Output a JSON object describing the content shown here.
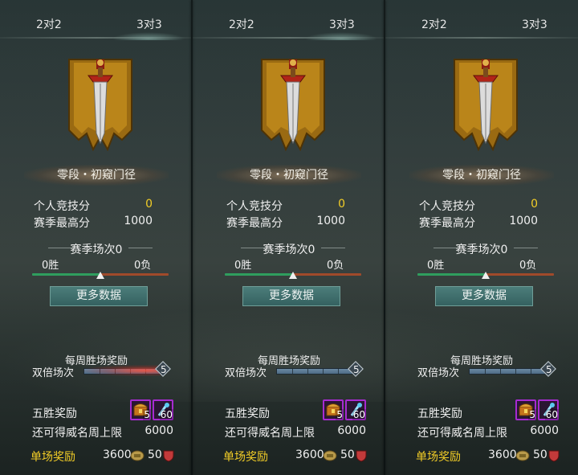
{
  "colors": {
    "accent_yellow": "#f2cd27",
    "button_teal": "#42706e",
    "item_border": "#a72bd1"
  },
  "panels": [
    {
      "tabs": [
        "2对2",
        "3对3"
      ],
      "rank_name": "零段・初窥门径",
      "personal_score_label": "个人竞技分",
      "personal_score": "0",
      "season_high_label": "赛季最高分",
      "season_high": "1000",
      "season_matches": "赛季场次0",
      "wins": "0胜",
      "losses": "0负",
      "more_data": "更多数据",
      "weekly_reward_title": "每周胜场奖励",
      "double_matches_label": "双倍场次",
      "double_matches_value": "5",
      "five_win_label": "五胜奖励",
      "item1_qty": "5",
      "item2_qty": "60",
      "remaining_label": "还可得威名周上限",
      "remaining_value": "6000",
      "single_reward_label": "单场奖励",
      "single_coin": "3600",
      "single_badge": "50"
    },
    {
      "tabs": [
        "2对2",
        "3对3"
      ],
      "rank_name": "零段・初窥门径",
      "personal_score_label": "个人竞技分",
      "personal_score": "0",
      "season_high_label": "赛季最高分",
      "season_high": "1000",
      "season_matches": "赛季场次0",
      "wins": "0胜",
      "losses": "0负",
      "more_data": "更多数据",
      "weekly_reward_title": "每周胜场奖励",
      "double_matches_label": "双倍场次",
      "double_matches_value": "5",
      "five_win_label": "五胜奖励",
      "item1_qty": "5",
      "item2_qty": "60",
      "remaining_label": "还可得威名周上限",
      "remaining_value": "6000",
      "single_reward_label": "单场奖励",
      "single_coin": "3600",
      "single_badge": "50"
    },
    {
      "tabs": [
        "2对2",
        "3对3"
      ],
      "rank_name": "零段・初窥门径",
      "personal_score_label": "个人竞技分",
      "personal_score": "0",
      "season_high_label": "赛季最高分",
      "season_high": "1000",
      "season_matches": "赛季场次0",
      "wins": "0胜",
      "losses": "0负",
      "more_data": "更多数据",
      "weekly_reward_title": "每周胜场奖励",
      "double_matches_label": "双倍场次",
      "double_matches_value": "5",
      "five_win_label": "五胜奖励",
      "item1_qty": "5",
      "item2_qty": "60",
      "remaining_label": "还可得威名周上限",
      "remaining_value": "6000",
      "single_reward_label": "单场奖励",
      "single_coin": "3600",
      "single_badge": "50"
    }
  ]
}
